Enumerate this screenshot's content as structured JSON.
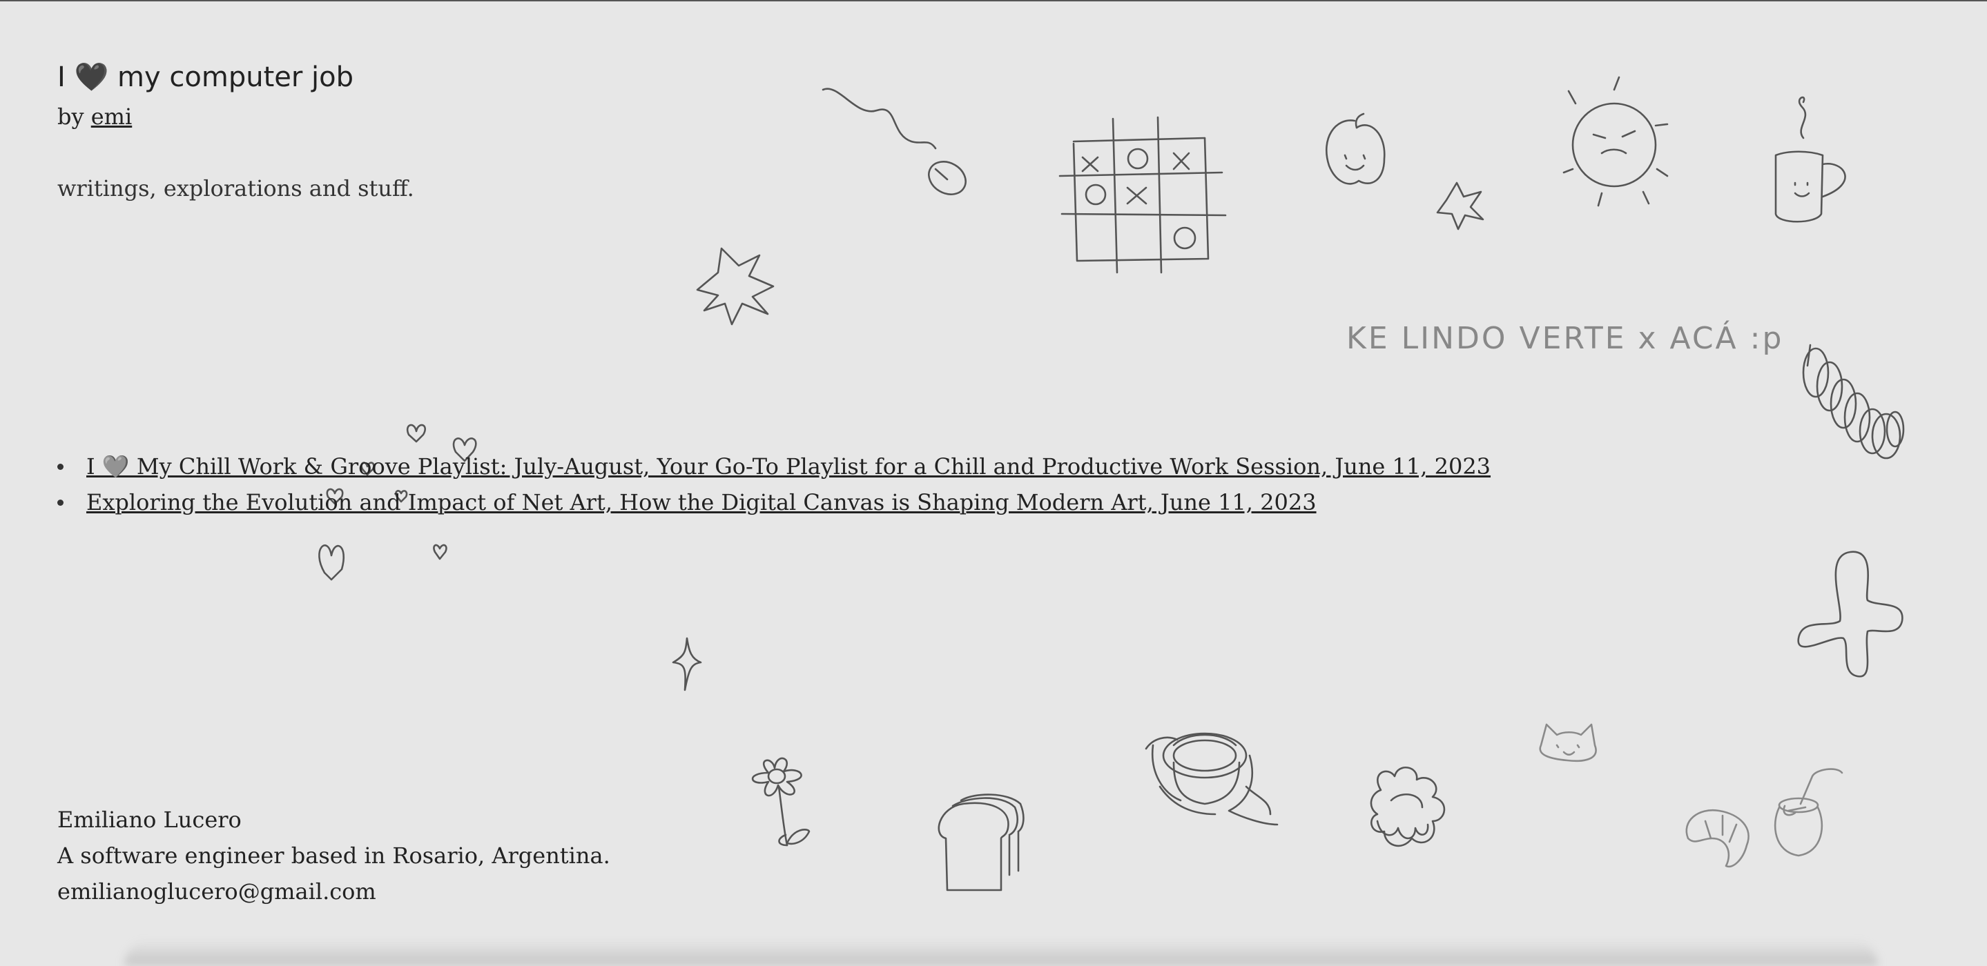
{
  "header": {
    "title_prefix": "I",
    "title_heart": "🖤",
    "title_suffix": "my computer job",
    "byline_prefix": "by",
    "author_link": "emi",
    "tagline": "writings, explorations and stuff."
  },
  "handwritten_note": "KE LINDO VERTE x ACÁ :p",
  "posts": [
    {
      "label": "I 🩶 My Chill Work & Groove Playlist: July-August, Your Go-To Playlist for a Chill and Productive Work Session, June 11, 2023"
    },
    {
      "label": "Exploring the Evolution and Impact of Net Art, How the Digital Canvas is Shaping Modern Art, June 11, 2023"
    }
  ],
  "footer": {
    "name": "Emiliano Lucero",
    "bio": "A software engineer based in Rosario, Argentina.",
    "email": "emilianoglucero@gmail.com"
  },
  "doodles": [
    "mouse-doodle",
    "tic-tac-toe-doodle",
    "apple-doodle",
    "sun-doodle",
    "mug-doodle",
    "star-doodle",
    "burst-doodle",
    "chain-doodle",
    "hearts-doodle",
    "sparkle-doodle",
    "blob-flower-doodle",
    "flower-doodle",
    "bread-doodle",
    "rope-basket-doodle",
    "cloud-swirl-doodle",
    "cat-doodle",
    "croissant-doodle",
    "mate-doodle"
  ]
}
